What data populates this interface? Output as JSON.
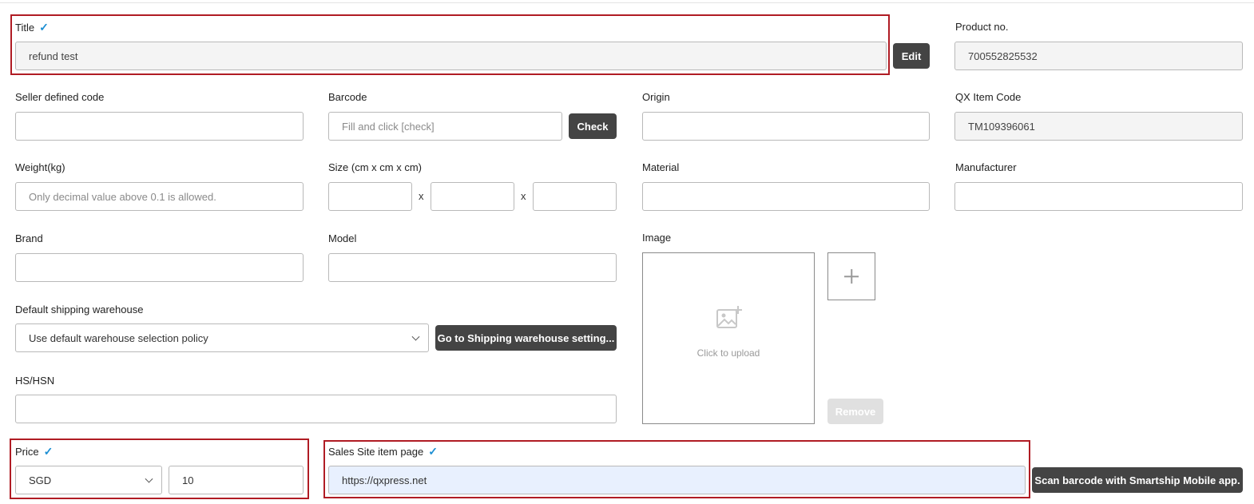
{
  "title": {
    "label": "Title",
    "value": "refund test",
    "edit_label": "Edit"
  },
  "product_no": {
    "label": "Product no.",
    "value": "700552825532"
  },
  "seller_code": {
    "label": "Seller defined code",
    "value": ""
  },
  "barcode": {
    "label": "Barcode",
    "placeholder": "Fill and click [check]",
    "check_label": "Check"
  },
  "origin": {
    "label": "Origin",
    "value": ""
  },
  "qx_item_code": {
    "label": "QX Item Code",
    "value": "TM109396061"
  },
  "weight": {
    "label": "Weight(kg)",
    "placeholder": "Only decimal value above 0.1 is allowed."
  },
  "size": {
    "label": "Size (cm x cm x cm)",
    "separator": "x"
  },
  "material": {
    "label": "Material"
  },
  "manufacturer": {
    "label": "Manufacturer"
  },
  "brand": {
    "label": "Brand"
  },
  "model": {
    "label": "Model"
  },
  "image": {
    "label": "Image",
    "upload_text": "Click to upload",
    "remove_label": "Remove"
  },
  "warehouse": {
    "label": "Default shipping warehouse",
    "selected": "Use default warehouse selection policy",
    "setting_button": "Go to Shipping warehouse setting..."
  },
  "hs_hsn": {
    "label": "HS/HSN"
  },
  "price": {
    "label": "Price",
    "currency": "SGD",
    "value": "10"
  },
  "sales_site": {
    "label": "Sales Site item page",
    "value": "https://qxpress.net",
    "scan_button": "Scan barcode with Smartship Mobile app."
  },
  "colors": {
    "accent_check": "#1d8fd3",
    "highlight_border": "#b01c24",
    "button_dark": "#444444"
  }
}
